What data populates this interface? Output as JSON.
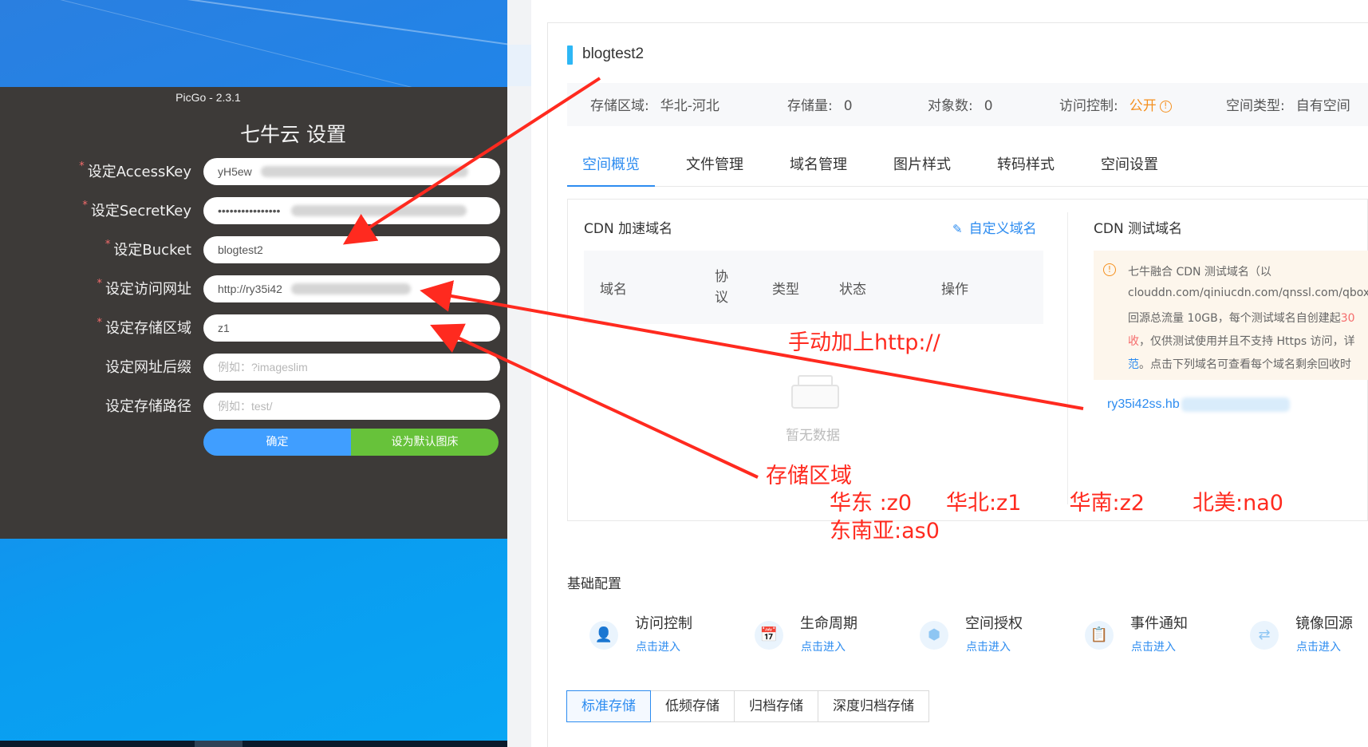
{
  "picgo": {
    "window_title": "PicGo - 2.3.1",
    "heading": "七牛云 设置",
    "fields": [
      {
        "label": "设定AccessKey",
        "required": true,
        "value": "yH5ew",
        "placeholder": ""
      },
      {
        "label": "设定SecretKey",
        "required": true,
        "value": "••••••••••••••••",
        "placeholder": ""
      },
      {
        "label": "设定Bucket",
        "required": true,
        "value": "blogtest2",
        "placeholder": ""
      },
      {
        "label": "设定访问网址",
        "required": true,
        "value": "http://ry35i42",
        "placeholder": ""
      },
      {
        "label": "设定存储区域",
        "required": true,
        "value": "z1",
        "placeholder": ""
      },
      {
        "label": "设定网址后缀",
        "required": false,
        "value": "",
        "placeholder": "例如：?imageslim"
      },
      {
        "label": "设定存储路径",
        "required": false,
        "value": "",
        "placeholder": "例如：test/"
      }
    ],
    "confirm_label": "确定",
    "default_label": "设为默认图床",
    "required_mark": "*"
  },
  "bucket": {
    "name": "blogtest2",
    "info": [
      {
        "label": "存储区域:",
        "value": "华北-河北"
      },
      {
        "label": "存储量:",
        "value": "0"
      },
      {
        "label": "对象数:",
        "value": "0"
      },
      {
        "label": "访问控制:",
        "value": "公开"
      },
      {
        "label": "空间类型:",
        "value": "自有空间"
      }
    ],
    "warn_glyph": "!"
  },
  "tabs": [
    "空间概览",
    "文件管理",
    "域名管理",
    "图片样式",
    "转码样式",
    "空间设置"
  ],
  "cdn": {
    "title": "CDN 加速域名",
    "custom_domain": "自定义域名",
    "columns": [
      "域名",
      "协\n议",
      "类型",
      "状态",
      "操作"
    ],
    "empty_text": "暂无数据",
    "test_title": "CDN 测试域名",
    "tip_lines": [
      "七牛融合 CDN 测试域名（以",
      "clouddn.com/qiniucdn.com/qnssl.com/qbox.m",
      "回源总流量 10GB，每个测试域名自创建起30",
      "收，仅供测试使用并且不支持 Https 访问，详",
      "范。点击下列域名可查看每个域名剩余回收时"
    ],
    "tip_red_1": "30",
    "tip_red_2": "收",
    "tip_blue": "范",
    "test_domain": "ry35i42ss.hb"
  },
  "basic": {
    "title": "基础配置",
    "items": [
      {
        "name": "访问控制",
        "link": "点击进入",
        "icon": "user-lock-icon"
      },
      {
        "name": "生命周期",
        "link": "点击进入",
        "icon": "calendar-clock-icon"
      },
      {
        "name": "空间授权",
        "link": "点击进入",
        "icon": "cube-share-icon"
      },
      {
        "name": "事件通知",
        "link": "点击进入",
        "icon": "notify-clipboard-icon"
      },
      {
        "name": "镜像回源",
        "link": "点击进入",
        "icon": "mirror-arrows-icon"
      }
    ]
  },
  "storage_tabs": [
    "标准存储",
    "低频存储",
    "归档存储",
    "深度归档存储"
  ],
  "annotations": {
    "manual_http": "手动加上http://",
    "region_title": "存储区域",
    "region_line1": "华东 :z0     华北:z1       华南:z2       北美:na0",
    "region_line2": "东南亚:as0"
  },
  "colors": {
    "accent": "#2d8cf0",
    "annotation_red": "#ff2a1f",
    "picgo_bg": "#3d3a38",
    "confirm_blue": "#409eff",
    "default_green": "#67c23a",
    "warn_orange": "#f5901e"
  }
}
